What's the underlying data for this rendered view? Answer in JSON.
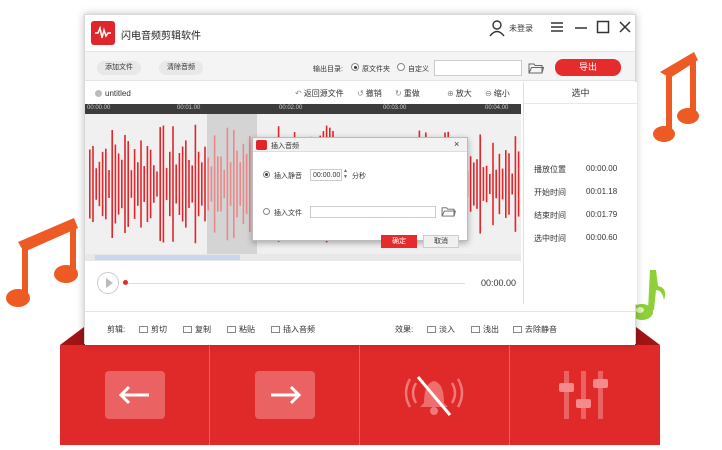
{
  "app": {
    "title": "闪电音频剪辑软件",
    "user_label": "未登录"
  },
  "toolbar": {
    "add_file": "添加文件",
    "clear_audio": "清除音频",
    "output_label": "输出目录:",
    "radio_source": "原文件夹",
    "radio_custom": "自定义",
    "path_value": "",
    "export": "导出"
  },
  "filebar": {
    "file_name": "untitled",
    "back_to_source": "返回源文件",
    "undo": "撤销",
    "redo": "重做",
    "zoom_in": "放大",
    "zoom_out": "缩小"
  },
  "timeline": {
    "ticks": [
      "00:00.00",
      "00:01.00",
      "00:02.00",
      "00:03.00",
      "00:04.00"
    ]
  },
  "side": {
    "title": "选中",
    "rows": [
      {
        "label": "播放位置",
        "value": "00:00.00"
      },
      {
        "label": "开始时间",
        "value": "00:01.18"
      },
      {
        "label": "结束时间",
        "value": "00:01.79"
      },
      {
        "label": "选中时间",
        "value": "00:00.60"
      }
    ]
  },
  "player": {
    "time": "00:00.00",
    "progress": 0
  },
  "editbar": {
    "edit_label": "剪辑:",
    "cut": "剪切",
    "copy": "复制",
    "paste": "粘贴",
    "insert_audio": "插入音频",
    "effect_label": "效果:",
    "fade_in": "淡入",
    "fade_out": "浅出",
    "remove_silence": "去除静音"
  },
  "dialog": {
    "title": "插入音频",
    "insert_silence": "插入静音",
    "silence_value": "00:00.00",
    "unit": "分秒",
    "insert_file": "插入文件",
    "file_value": "",
    "ok": "确定",
    "cancel": "取消"
  },
  "colors": {
    "accent": "#e52b2b",
    "wave": "#e0262b",
    "panel": "#e02a2a",
    "note_orange": "#ee5a24",
    "note_green": "#8fcf3a"
  }
}
